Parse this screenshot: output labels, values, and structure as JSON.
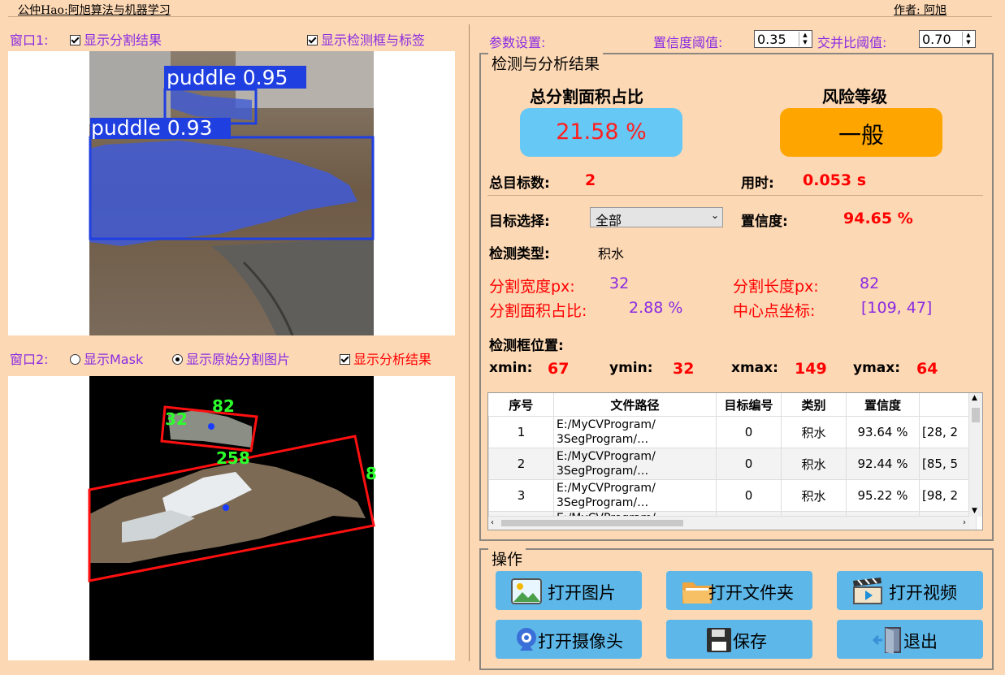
{
  "header": {
    "left": "公仲Hao:阿旭算法与机器学习",
    "right": "作者: 阿旭"
  },
  "window1": {
    "label": "窗口1:",
    "check_seg": "显示分割结果",
    "check_det": "显示检测框与标签",
    "detections": [
      {
        "label": "puddle 0.95"
      },
      {
        "label": "puddle 0.93"
      }
    ]
  },
  "window2": {
    "label": "窗口2:",
    "radio_mask": "显示Mask",
    "radio_orig": "显示原始分割图片",
    "check_analysis": "显示分析结果",
    "annotations": [
      "82",
      "32",
      "258",
      "8"
    ]
  },
  "params": {
    "label": "参数设置:",
    "conf_label": "置信度阈值:",
    "conf_value": "0.35",
    "iou_label": "交并比阈值:",
    "iou_value": "0.70"
  },
  "results": {
    "title": "检测与分析结果",
    "area_title": "总分割面积占比",
    "area_value": "21.58 %",
    "risk_title": "风险等级",
    "risk_value": "一般",
    "total_label": "总目标数:",
    "total_value": "2",
    "time_label": "用时:",
    "time_value": "0.053 s",
    "target_label": "目标选择:",
    "target_value": "全部",
    "conf_label": "置信度:",
    "conf_value": "94.65 %",
    "type_label": "检测类型:",
    "type_value": "积水",
    "seg_width_label": "分割宽度px:",
    "seg_width_value": "32",
    "seg_len_label": "分割长度px:",
    "seg_len_value": "82",
    "seg_area_label": "分割面积占比:",
    "seg_area_value": "2.88 %",
    "center_label": "中心点坐标:",
    "center_value": "[109, 47]",
    "box_label": "检测框位置:",
    "xmin_label": "xmin:",
    "xmin_value": "67",
    "ymin_label": "ymin:",
    "ymin_value": "32",
    "xmax_label": "xmax:",
    "xmax_value": "149",
    "ymax_label": "ymax:",
    "ymax_value": "64"
  },
  "table": {
    "headers": [
      "序号",
      "文件路径",
      "目标编号",
      "类别",
      "置信度"
    ],
    "rows": [
      {
        "idx": "1",
        "path1": "E:/MyCVProgram/",
        "path2": "3SegProgram/…",
        "id": "0",
        "cls": "积水",
        "conf": "93.64 %",
        "box": "[28, 2"
      },
      {
        "idx": "2",
        "path1": "E:/MyCVProgram/",
        "path2": "3SegProgram/…",
        "id": "0",
        "cls": "积水",
        "conf": "92.44 %",
        "box": "[85, 5"
      },
      {
        "idx": "3",
        "path1": "E:/MyCVProgram/",
        "path2": "3SegProgram/…",
        "id": "0",
        "cls": "积水",
        "conf": "95.22 %",
        "box": "[98, 2"
      }
    ],
    "partial_row": "E:/MyCVProgram/"
  },
  "ops": {
    "title": "操作",
    "open_image": "打开图片",
    "open_folder": "打开文件夹",
    "open_video": "打开视频",
    "open_camera": "打开摄像头",
    "save": "保存",
    "exit": "退出"
  },
  "colors": {
    "background": "#fdd8b4",
    "area_card": "#66c8f4",
    "risk_card": "#ffa500",
    "button": "#5db7e8",
    "label_purple": "#8a2be2",
    "value_red": "#ff0000"
  }
}
